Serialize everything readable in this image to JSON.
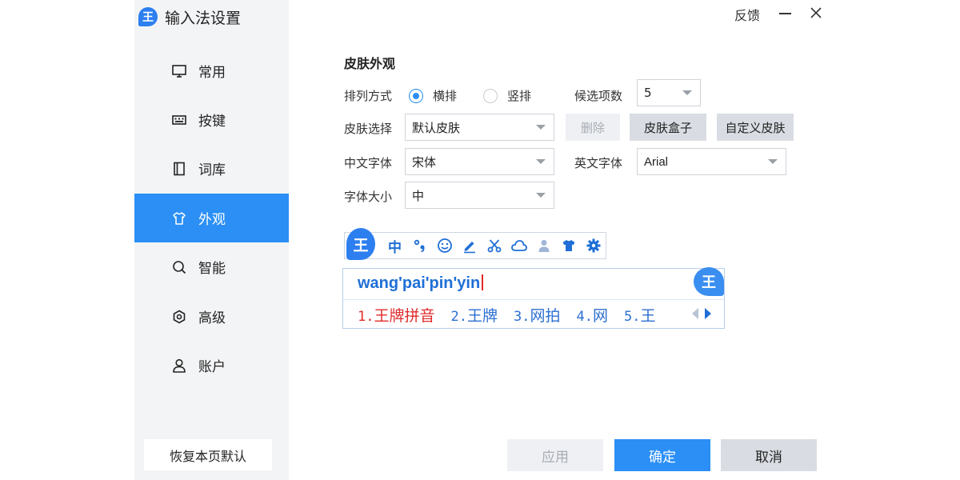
{
  "app": {
    "title": "输入法设置",
    "logo_char": "王",
    "feedback_label": "反馈"
  },
  "sidebar": {
    "items": [
      {
        "label": "常用",
        "icon": "monitor-icon"
      },
      {
        "label": "按键",
        "icon": "keyboard-icon"
      },
      {
        "label": "词库",
        "icon": "book-icon"
      },
      {
        "label": "外观",
        "icon": "shirt-icon",
        "active": true
      },
      {
        "label": "智能",
        "icon": "search-icon"
      },
      {
        "label": "高级",
        "icon": "hexagon-gear-icon"
      },
      {
        "label": "账户",
        "icon": "user-icon"
      }
    ],
    "reset_label": "恢复本页默认"
  },
  "skin": {
    "section_title": "皮肤外观",
    "layout_label": "排列方式",
    "layout_options": [
      "横排",
      "竖排"
    ],
    "layout_selected": "横排",
    "candidates_label": "候选项数",
    "candidates_value": "5",
    "skin_label": "皮肤选择",
    "skin_value": "默认皮肤",
    "delete_label": "删除",
    "skin_box_label": "皮肤盒子",
    "custom_skin_label": "自定义皮肤",
    "cn_font_label": "中文字体",
    "cn_font_value": "宋体",
    "en_font_label": "英文字体",
    "en_font_value": "Arial",
    "font_size_label": "字体大小",
    "font_size_value": "中"
  },
  "preview": {
    "toolbar_logo": "王",
    "toolbar_mode": "中",
    "toolbar_icons": [
      "chinese-mode-icon",
      "punctuation-icon",
      "emoji-icon",
      "pen-icon",
      "scissors-icon",
      "cloud-icon",
      "user-icon",
      "shirt-icon",
      "gear-icon"
    ],
    "pinyin": "wang'pai'pin'yin",
    "candidate_logo": "王",
    "candidates": [
      {
        "num": "1.",
        "text": "王牌拼音"
      },
      {
        "num": "2.",
        "text": "王牌"
      },
      {
        "num": "3.",
        "text": "网拍"
      },
      {
        "num": "4.",
        "text": "网"
      },
      {
        "num": "5.",
        "text": "王"
      }
    ]
  },
  "footer": {
    "apply_label": "应用",
    "ok_label": "确定",
    "cancel_label": "取消"
  },
  "colors": {
    "accent": "#2b8ff5",
    "sidebar_bg": "#f3f4f6",
    "candidate_highlight": "#e02b2b",
    "candidate_text": "#2b6fd1"
  }
}
